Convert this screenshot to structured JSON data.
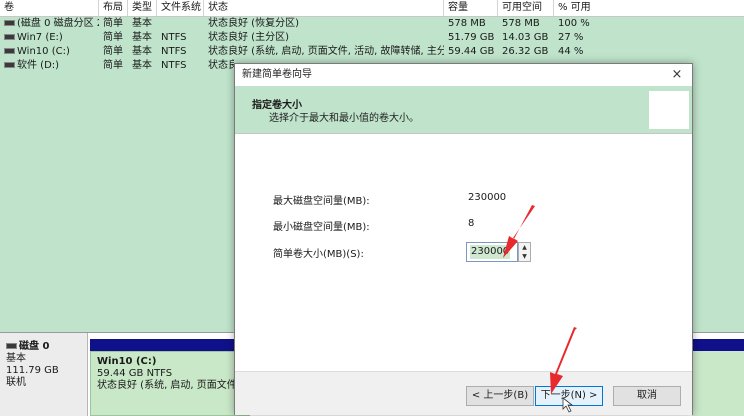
{
  "columns": [
    "卷",
    "布局",
    "类型",
    "文件系统",
    "状态",
    "容量",
    "可用空间",
    "% 可用"
  ],
  "volumes": [
    {
      "name": "(磁盘 0 磁盘分区 2)",
      "layout": "简单",
      "type": "基本",
      "fs": "",
      "status": "状态良好 (恢复分区)",
      "capacity": "578 MB",
      "free": "578 MB",
      "pct": "100 %"
    },
    {
      "name": "Win7 (E:)",
      "layout": "简单",
      "type": "基本",
      "fs": "NTFS",
      "status": "状态良好 (主分区)",
      "capacity": "51.79 GB",
      "free": "14.03 GB",
      "pct": "27 %"
    },
    {
      "name": "Win10 (C:)",
      "layout": "简单",
      "type": "基本",
      "fs": "NTFS",
      "status": "状态良好 (系统, 启动, 页面文件, 活动, 故障转储, 主分区)",
      "capacity": "59.44 GB",
      "free": "26.32 GB",
      "pct": "44 %"
    },
    {
      "name": "软件 (D:)",
      "layout": "简单",
      "type": "基本",
      "fs": "NTFS",
      "status": "状态良",
      "capacity": "",
      "free": "",
      "pct": ""
    }
  ],
  "disk": {
    "name": "磁盘 0",
    "type": "基本",
    "size": "111.79 GB",
    "state": "联机",
    "partition": {
      "name": "Win10  (C:)",
      "size": "59.44 GB NTFS",
      "status": "状态良好 (系统, 启动, 页面文件, 活"
    }
  },
  "dialog": {
    "title": "新建简单卷向导",
    "close": "×",
    "heading": "指定卷大小",
    "subheading": "选择介于最大和最小值的卷大小。",
    "max_label": "最大磁盘空间量(MB):",
    "max_value": "230000",
    "min_label": "最小磁盘空间量(MB):",
    "min_value": "8",
    "size_label": "简单卷大小(MB)(S):",
    "size_value": "230000",
    "spin_up": "▲",
    "spin_down": "▼",
    "back_label": "< 上一步(B)",
    "next_label": "下一步(N) >",
    "cancel_label": "取消"
  },
  "colors": {
    "desktop_green": "#bfe3cb",
    "disk_bar": "#10108a",
    "partition_fill": "#c9e8c8",
    "annotation_arrow": "#e8292d",
    "accent_button_border": "#0078d7"
  },
  "icons": [
    "disk-icon",
    "close-icon",
    "spin-up-icon",
    "spin-down-icon",
    "mouse-cursor-icon",
    "arrow-annotation"
  ]
}
